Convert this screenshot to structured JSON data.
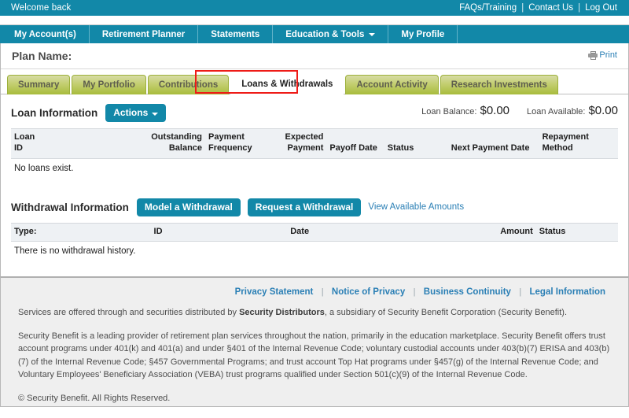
{
  "topbar": {
    "welcome_text": "Welcome back",
    "links": [
      {
        "label": "FAQs/Training"
      },
      {
        "label": "Contact Us"
      },
      {
        "label": "Log Out"
      }
    ],
    "separator": "|",
    "background_color": "#1288a8"
  },
  "nav": {
    "items": [
      {
        "label": "My Account(s)",
        "has_caret": false
      },
      {
        "label": "Retirement Planner",
        "has_caret": false
      },
      {
        "label": "Statements",
        "has_caret": false
      },
      {
        "label": "Education & Tools",
        "has_caret": true
      },
      {
        "label": "My Profile",
        "has_caret": false
      }
    ]
  },
  "plan_header": {
    "title": "Plan Name:",
    "print_label": "Print"
  },
  "tabs": {
    "active_index": 3,
    "highlight_color": "#ee1b17",
    "items": [
      {
        "label": "Summary"
      },
      {
        "label": "My Portfolio"
      },
      {
        "label": "Contributions"
      },
      {
        "label": "Loans & Withdrawals"
      },
      {
        "label": "Account Activity"
      },
      {
        "label": "Research Investments"
      }
    ]
  },
  "loan_section": {
    "title": "Loan Information",
    "actions_label": "Actions",
    "balances": [
      {
        "label": "Loan Balance:",
        "value": "$0.00"
      },
      {
        "label": "Loan Available:",
        "value": "$0.00"
      }
    ],
    "columns": [
      {
        "line1": "Loan",
        "line2": "ID",
        "align": "left"
      },
      {
        "line1": "Outstanding",
        "line2": "Balance",
        "align": "right"
      },
      {
        "line1": "Payment",
        "line2": "Frequency",
        "align": "left"
      },
      {
        "line1": "Expected",
        "line2": "Payment",
        "align": "right"
      },
      {
        "line1": "",
        "line2": "Payoff Date",
        "align": "left"
      },
      {
        "line1": "",
        "line2": "Status",
        "align": "left"
      },
      {
        "line1": "",
        "line2": "Next Payment Date",
        "align": "left"
      },
      {
        "line1": "Repayment",
        "line2": "Method",
        "align": "left"
      }
    ],
    "empty_message": "No loans exist."
  },
  "withdrawal_section": {
    "title": "Withdrawal Information",
    "model_button": "Model a Withdrawal",
    "request_button": "Request a Withdrawal",
    "view_amounts_link": "View Available Amounts",
    "columns": [
      {
        "label": "Type:",
        "align": "left"
      },
      {
        "label": "ID",
        "align": "left"
      },
      {
        "label": "Date",
        "align": "left"
      },
      {
        "label": "Amount",
        "align": "right"
      },
      {
        "label": "Status",
        "align": "left"
      }
    ],
    "empty_message": "There is no withdrawal history."
  },
  "footer": {
    "links": [
      {
        "label": "Privacy Statement"
      },
      {
        "label": "Notice of Privacy"
      },
      {
        "label": "Business Continuity"
      },
      {
        "label": "Legal Information"
      }
    ],
    "separator": "|",
    "paragraph_1_pre": "Services are offered through and securities distributed by ",
    "paragraph_1_bold": "Security Distributors",
    "paragraph_1_post": ", a subsidiary of Security Benefit Corporation (Security Benefit).",
    "paragraph_2": "Security Benefit is a leading provider of retirement plan services throughout the nation, primarily in the education marketplace. Security Benefit offers trust account programs under 401(k) and 401(a) and under §401 of the Internal Revenue Code; voluntary custodial accounts under 403(b)(7) ERISA and 403(b)(7) of the Internal Revenue Code; §457 Governmental Programs; and trust account Top Hat programs under §457(g) of the Internal Revenue Code; and Voluntary Employees' Beneficiary Association (VEBA) trust programs qualified under Section 501(c)(9) of the Internal Revenue Code.",
    "copyright": "© Security Benefit. All Rights Reserved."
  }
}
